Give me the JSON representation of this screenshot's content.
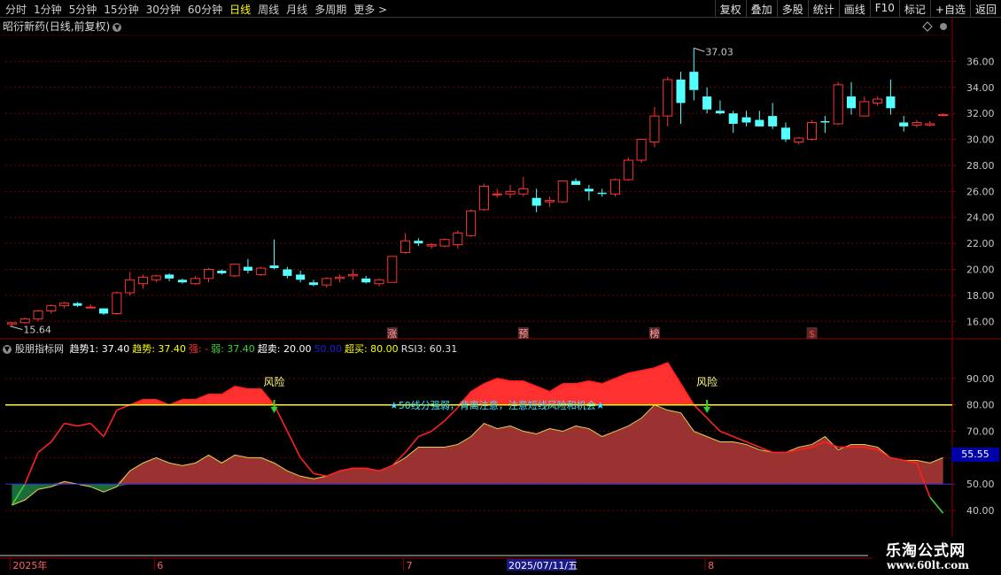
{
  "toolbar": {
    "periods": [
      "分时",
      "1分钟",
      "5分钟",
      "15分钟",
      "30分钟",
      "60分钟",
      "日线",
      "周线",
      "月线",
      "多周期",
      "更多 >"
    ],
    "active_period": "日线",
    "actions": [
      "复权",
      "叠加",
      "多股",
      "统计",
      "画线",
      "F10",
      "标记",
      "+自选",
      "返回"
    ]
  },
  "stock": {
    "name": "昭衍新药",
    "mode": "(日线,前复权)"
  },
  "price_labels": {
    "high": "37.03",
    "low": "15.64"
  },
  "event_markers": [
    {
      "label": "涨",
      "index": 29
    },
    {
      "label": "预",
      "index": 39
    },
    {
      "label": "榜",
      "index": 49
    },
    {
      "label": "$",
      "index": 61
    }
  ],
  "indicator": {
    "name": "股朋指标网",
    "fields": [
      {
        "label": "趋势1:",
        "value": "37.40",
        "color": "#ffffff"
      },
      {
        "label": "趋势:",
        "value": "37.40",
        "color": "#ffff00"
      },
      {
        "label": "强:",
        "value": "-",
        "color": "#ff3030"
      },
      {
        "label": "弱:",
        "value": "37.40",
        "color": "#3cd23c"
      },
      {
        "label": "超卖:",
        "value": "20.00",
        "color": "#ffffff"
      },
      {
        "label": "",
        "value": "50.00",
        "color": "#2020d0"
      },
      {
        "label": "超买:",
        "value": "80.00",
        "color": "#ffff00"
      },
      {
        "label": "RSI3:",
        "value": "60.31",
        "color": "#e0e0e0"
      }
    ],
    "annotations": [
      {
        "text": "风险",
        "index": 20
      },
      {
        "text": "风险",
        "index": 53
      }
    ],
    "center_note": "★50线分强弱，背离注意，注意短线风险和机会★",
    "current_value": "55.55"
  },
  "time_axis": {
    "labels": [
      {
        "text": "2025年",
        "index": 0
      },
      {
        "text": "6",
        "index": 11
      },
      {
        "text": "7",
        "index": 30
      },
      {
        "text": "2025/07/11/五",
        "index": 38,
        "highlight": true
      },
      {
        "text": "8",
        "index": 53
      }
    ]
  },
  "watermark": {
    "line1": "乐淘公式网",
    "line2": "www.60lt.com"
  },
  "chart_data": [
    {
      "type": "candlestick",
      "title": "昭衍新药(日线,前复权)",
      "ylim": [
        15,
        38
      ],
      "yticks": [
        16,
        18,
        20,
        22,
        24,
        26,
        28,
        30,
        32,
        34,
        36
      ],
      "grid": true,
      "candles": [
        [
          15.8,
          15.95,
          15.64,
          15.9
        ],
        [
          15.9,
          16.3,
          15.8,
          16.2
        ],
        [
          16.2,
          16.9,
          16.0,
          16.8
        ],
        [
          16.8,
          17.3,
          16.6,
          17.2
        ],
        [
          17.2,
          17.5,
          17.0,
          17.4
        ],
        [
          17.4,
          17.5,
          17.1,
          17.2
        ],
        [
          17.1,
          17.3,
          17.0,
          17.1
        ],
        [
          17.0,
          17.0,
          16.5,
          16.6
        ],
        [
          16.6,
          18.3,
          16.5,
          18.2
        ],
        [
          18.2,
          19.8,
          18.0,
          19.2
        ],
        [
          18.9,
          19.6,
          18.5,
          19.4
        ],
        [
          19.2,
          19.6,
          19.0,
          19.5
        ],
        [
          19.6,
          19.7,
          19.1,
          19.3
        ],
        [
          19.2,
          19.3,
          18.9,
          19.0
        ],
        [
          18.9,
          19.5,
          18.8,
          19.3
        ],
        [
          19.3,
          20.1,
          19.0,
          20.0
        ],
        [
          19.9,
          20.0,
          19.6,
          19.7
        ],
        [
          19.5,
          20.4,
          19.4,
          20.4
        ],
        [
          20.2,
          20.8,
          19.7,
          19.9
        ],
        [
          19.6,
          20.2,
          19.5,
          20.1
        ],
        [
          20.3,
          22.3,
          20.0,
          20.1
        ],
        [
          20.0,
          20.2,
          19.3,
          19.5
        ],
        [
          19.6,
          19.9,
          19.0,
          19.2
        ],
        [
          19.0,
          19.2,
          18.7,
          18.8
        ],
        [
          18.8,
          19.4,
          18.6,
          19.3
        ],
        [
          19.3,
          19.6,
          19.0,
          19.4
        ],
        [
          19.5,
          20.0,
          19.2,
          19.6
        ],
        [
          19.3,
          19.5,
          18.9,
          19.0
        ],
        [
          18.9,
          19.3,
          18.7,
          19.2
        ],
        [
          19.0,
          21.0,
          19.0,
          21.0
        ],
        [
          21.3,
          22.8,
          21.2,
          22.2
        ],
        [
          22.2,
          22.4,
          21.8,
          22.0
        ],
        [
          21.8,
          22.0,
          21.6,
          21.9
        ],
        [
          21.8,
          22.4,
          21.7,
          22.3
        ],
        [
          21.9,
          23.0,
          21.6,
          22.8
        ],
        [
          22.6,
          24.6,
          22.5,
          24.5
        ],
        [
          24.6,
          26.6,
          24.5,
          26.4
        ],
        [
          25.8,
          26.2,
          25.5,
          25.8
        ],
        [
          25.8,
          26.5,
          25.5,
          26.0
        ],
        [
          25.8,
          27.1,
          25.6,
          26.2
        ],
        [
          25.5,
          26.2,
          24.4,
          24.9
        ],
        [
          25.2,
          25.6,
          24.8,
          25.3
        ],
        [
          25.2,
          26.8,
          25.1,
          26.8
        ],
        [
          26.8,
          27.0,
          26.5,
          26.5
        ],
        [
          26.2,
          26.5,
          25.3,
          26.0
        ],
        [
          25.9,
          26.2,
          25.6,
          25.8
        ],
        [
          25.8,
          27.0,
          25.6,
          26.9
        ],
        [
          26.9,
          28.6,
          26.8,
          28.4
        ],
        [
          28.4,
          30.0,
          28.2,
          30.0
        ],
        [
          29.8,
          32.5,
          29.4,
          31.8
        ],
        [
          31.8,
          34.8,
          31.0,
          34.6
        ],
        [
          34.6,
          35.2,
          31.2,
          32.8
        ],
        [
          35.2,
          37.03,
          33.0,
          33.8
        ],
        [
          33.3,
          34.0,
          32.0,
          32.3
        ],
        [
          32.2,
          33.0,
          31.9,
          32.0
        ],
        [
          32.0,
          32.2,
          30.5,
          31.2
        ],
        [
          31.7,
          32.2,
          31.0,
          31.3
        ],
        [
          31.5,
          32.2,
          31.2,
          31.0
        ],
        [
          31.8,
          32.8,
          30.8,
          31.0
        ],
        [
          30.9,
          31.3,
          29.8,
          30.0
        ],
        [
          29.8,
          30.2,
          29.6,
          30.1
        ],
        [
          30.0,
          31.5,
          29.9,
          31.3
        ],
        [
          31.4,
          31.8,
          30.5,
          31.3
        ],
        [
          31.2,
          34.4,
          31.1,
          34.2
        ],
        [
          33.3,
          34.4,
          31.9,
          32.4
        ],
        [
          31.8,
          33.3,
          31.8,
          32.9
        ],
        [
          32.8,
          33.3,
          32.6,
          33.1
        ],
        [
          33.3,
          34.6,
          31.9,
          32.4
        ],
        [
          31.3,
          31.8,
          30.6,
          31.0
        ],
        [
          31.1,
          31.5,
          30.9,
          31.3
        ],
        [
          31.1,
          31.4,
          31.0,
          31.2
        ],
        [
          31.9,
          32.0,
          31.9,
          31.9
        ]
      ]
    },
    {
      "type": "line",
      "title": "股朋指标网",
      "ylim": [
        35,
        100
      ],
      "yticks": [
        40,
        50,
        60,
        70,
        80,
        90
      ],
      "hlines": {
        "over_sold": 20,
        "middle": 50,
        "over_bought": 80
      },
      "series": [
        {
          "name": "强",
          "values": [
            42,
            44,
            48,
            49,
            51,
            50,
            49,
            47,
            49,
            55,
            58,
            60,
            58,
            57,
            58,
            61,
            58,
            61,
            60,
            60,
            58,
            55,
            53,
            52,
            53,
            55,
            56,
            56,
            55,
            57,
            60,
            64,
            64,
            64,
            65,
            68,
            73,
            71,
            72,
            70,
            69,
            71,
            70,
            72,
            71,
            68,
            70,
            72,
            75,
            80,
            78,
            77,
            70,
            68,
            66,
            66,
            65,
            63,
            62,
            62,
            64,
            65,
            68,
            63,
            65,
            65,
            64,
            60,
            59,
            59,
            58,
            60
          ]
        },
        {
          "name": "RSI3",
          "values": [
            42,
            50,
            62,
            66,
            73,
            72,
            73,
            68,
            78,
            80,
            82,
            82,
            80,
            82,
            82,
            84,
            84,
            87,
            86,
            86,
            80,
            70,
            60,
            54,
            53,
            55,
            56,
            56,
            55,
            57,
            62,
            68,
            70,
            74,
            79,
            85,
            88,
            90,
            89,
            89,
            87,
            85,
            88,
            88,
            89,
            88,
            90,
            92,
            93,
            94,
            96,
            88,
            80,
            75,
            70,
            68,
            66,
            64,
            62,
            62,
            63,
            64,
            66,
            64,
            64,
            64,
            63,
            60,
            59,
            58,
            45,
            39
          ]
        }
      ]
    }
  ]
}
